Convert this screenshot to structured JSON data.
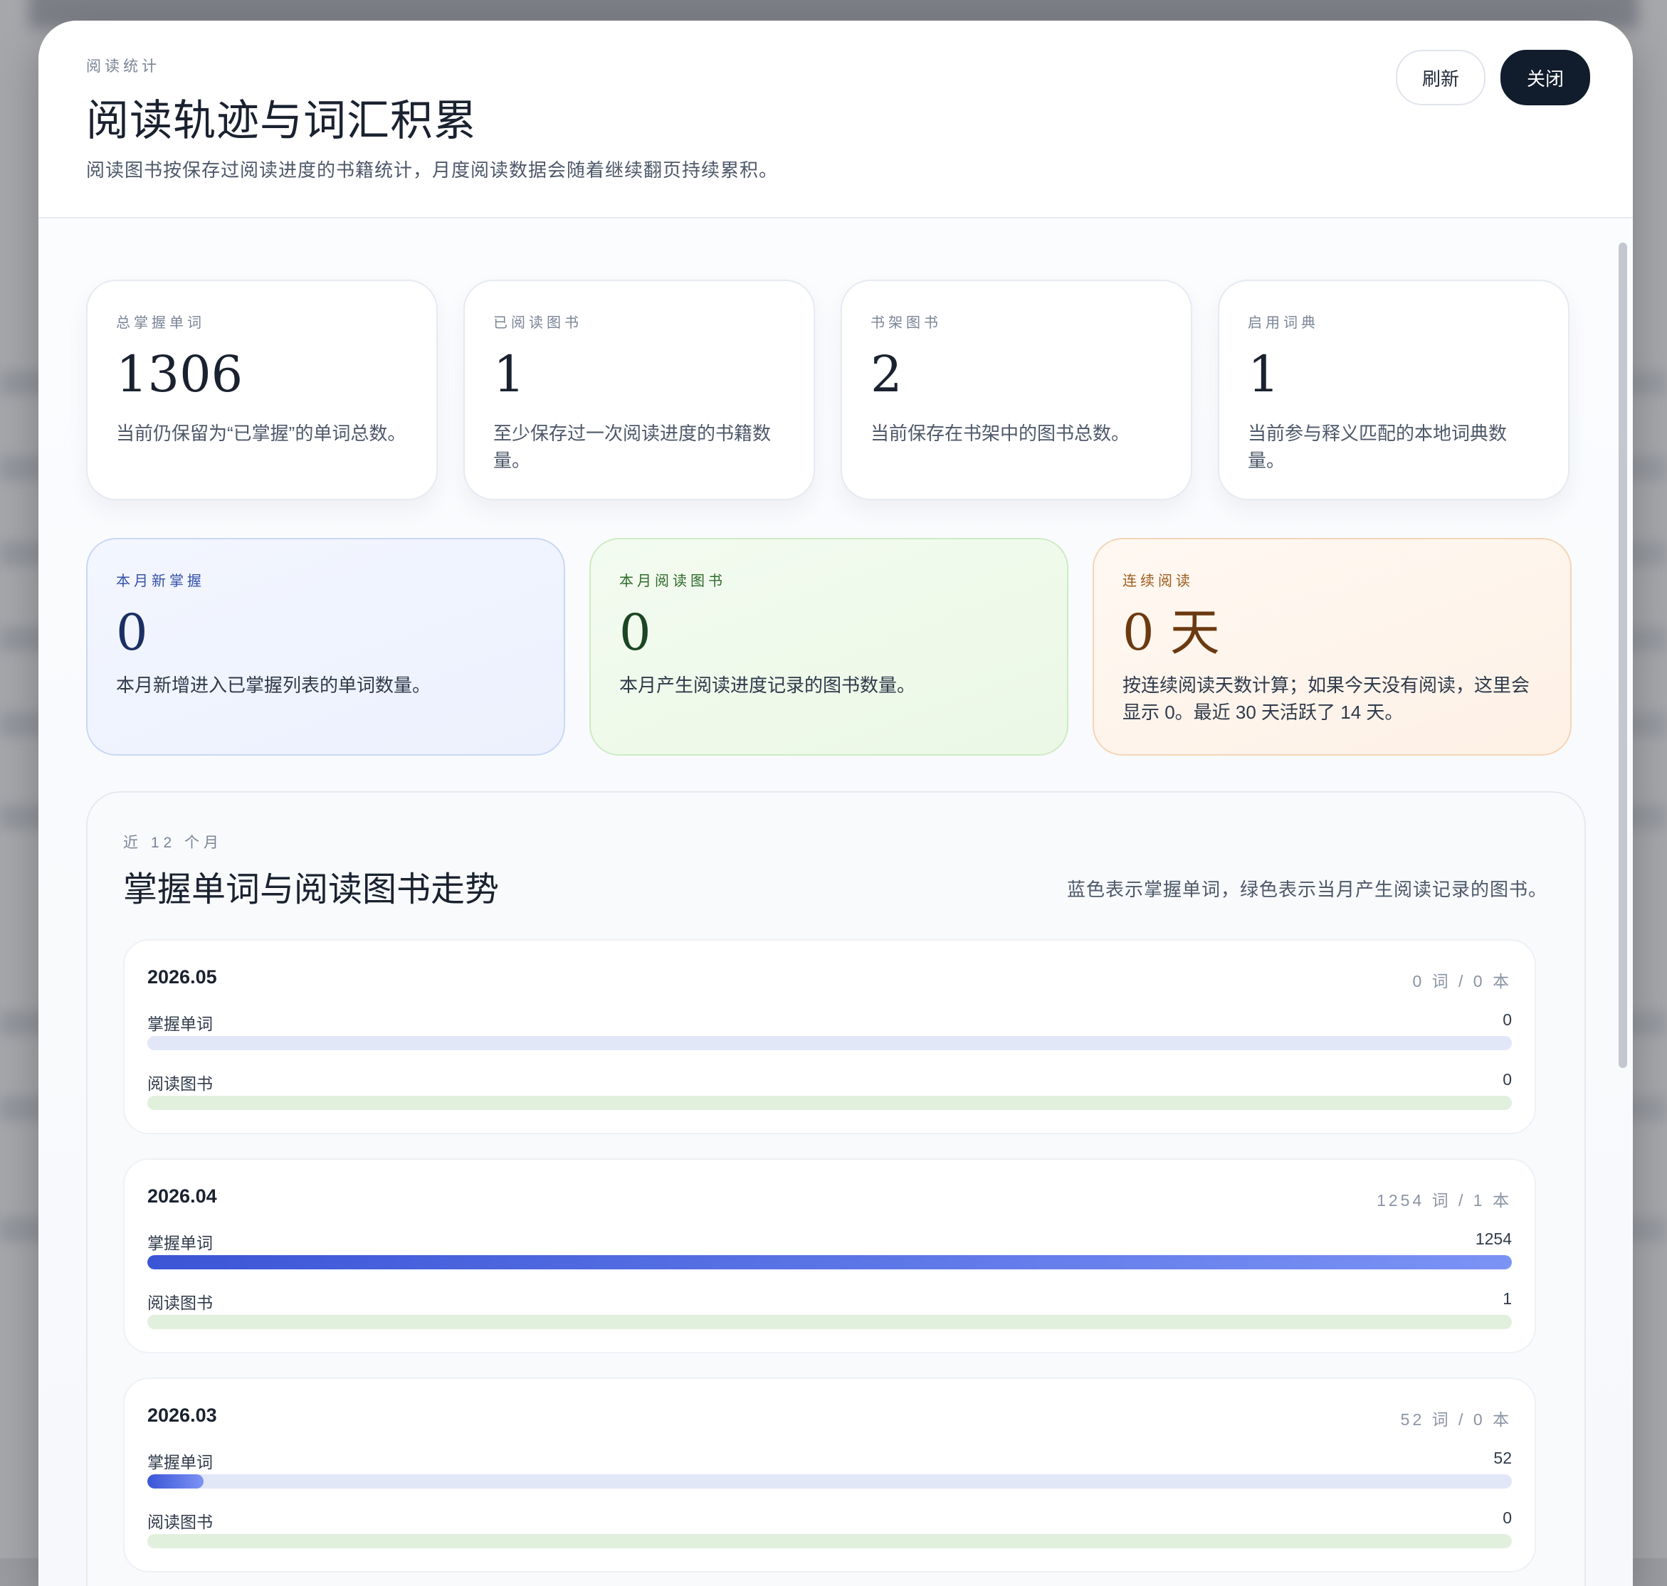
{
  "modal": {
    "eyebrow": "阅读统计",
    "title": "阅读轨迹与词汇积累",
    "description": "阅读图书按保存过阅读进度的书籍统计，月度阅读数据会随着继续翻页持续累积。",
    "refresh_label": "刷新",
    "close_label": "关闭"
  },
  "stats": [
    {
      "label": "总掌握单词",
      "value": "1306",
      "desc": "当前仍保留为“已掌握”的单词总数。"
    },
    {
      "label": "已阅读图书",
      "value": "1",
      "desc": "至少保存过一次阅读进度的书籍数量。"
    },
    {
      "label": "书架图书",
      "value": "2",
      "desc": "当前保存在书架中的图书总数。"
    },
    {
      "label": "启用词典",
      "value": "1",
      "desc": "当前参与释义匹配的本地词典数量。"
    }
  ],
  "monthly": [
    {
      "label": "本月新掌握",
      "value": "0",
      "desc": "本月新增进入已掌握列表的单词数量。"
    },
    {
      "label": "本月阅读图书",
      "value": "0",
      "desc": "本月产生阅读进度记录的图书数量。"
    },
    {
      "label": "连续阅读",
      "value": "0 天",
      "desc": "按连续阅读天数计算；如果今天没有阅读，这里会显示 0。最近 30 天活跃了 14 天。"
    }
  ],
  "trend": {
    "eyebrow": "近 12 个月",
    "title": "掌握单词与阅读图书走势",
    "note": "蓝色表示掌握单词，绿色表示当月产生阅读记录的图书。",
    "words_label": "掌握单词",
    "books_label": "阅读图书",
    "max_words": 1254,
    "max_books": 1,
    "rows": [
      {
        "month": "2026.05",
        "summary": "0 词 / 0 本",
        "words": 0,
        "words_text": "0",
        "books": 0,
        "books_text": "0"
      },
      {
        "month": "2026.04",
        "summary": "1254 词 / 1 本",
        "words": 1254,
        "words_text": "1254",
        "books": 1,
        "books_text": "1",
        "books_bar_hidden": true
      },
      {
        "month": "2026.03",
        "summary": "52 词 / 0 本",
        "words": 52,
        "words_text": "52",
        "books": 0,
        "books_text": "0"
      }
    ]
  },
  "colors": {
    "accent_dark": "#111c2c",
    "words_bar": "#3b55d6",
    "books_track": "#e1f0dd"
  }
}
